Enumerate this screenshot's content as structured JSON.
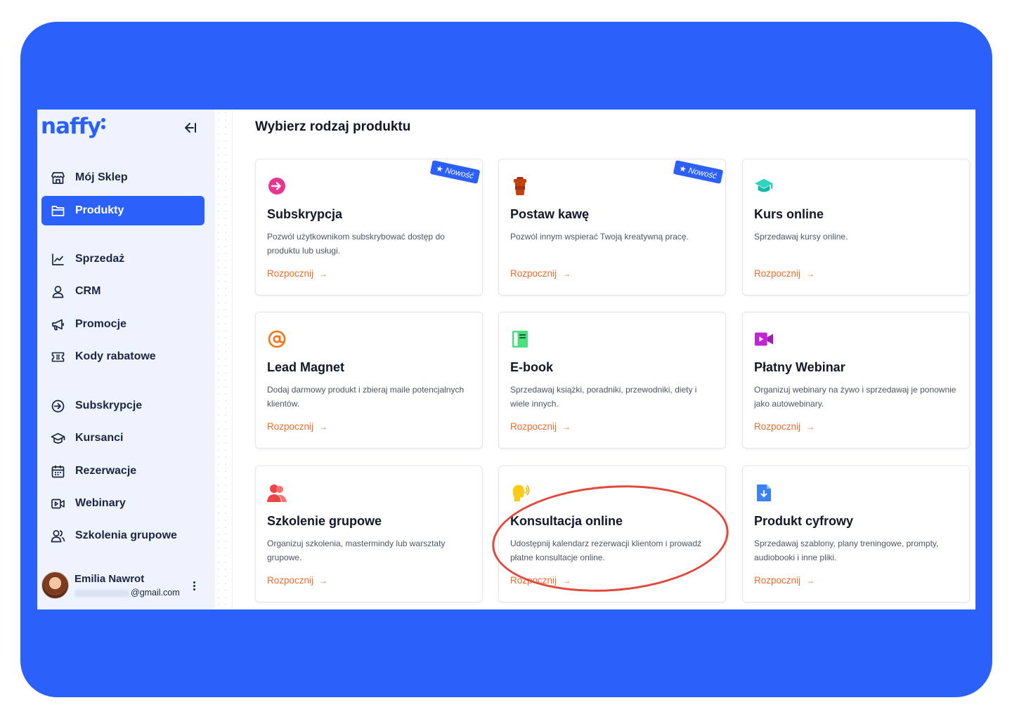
{
  "app": {
    "logo": "naffy"
  },
  "sidebar": {
    "items": [
      {
        "label": "Mój Sklep",
        "icon": "store-icon",
        "active": false
      },
      {
        "label": "Produkty",
        "icon": "folder-icon",
        "active": true
      },
      {
        "label": "Sprzedaż",
        "icon": "chart-line-icon",
        "active": false
      },
      {
        "label": "CRM",
        "icon": "user-icon",
        "active": false
      },
      {
        "label": "Promocje",
        "icon": "megaphone-icon",
        "active": false
      },
      {
        "label": "Kody rabatowe",
        "icon": "ticket-icon",
        "active": false
      },
      {
        "label": "Subskrypcje",
        "icon": "subscription-icon",
        "active": false
      },
      {
        "label": "Kursanci",
        "icon": "graduation-cap-icon",
        "active": false
      },
      {
        "label": "Rezerwacje",
        "icon": "calendar-icon",
        "active": false
      },
      {
        "label": "Webinary",
        "icon": "video-icon",
        "active": false
      },
      {
        "label": "Szkolenia grupowe",
        "icon": "users-icon",
        "active": false
      }
    ],
    "user": {
      "name": "Emilia Nawrot",
      "email_suffix": "@gmail.com"
    }
  },
  "main": {
    "title": "Wybierz rodzaj produktu",
    "start_label": "Rozpocznij",
    "badge_label": "★ Nowość",
    "cards": [
      {
        "title": "Subskrypcja",
        "desc": "Pozwól użytkownikom subskrybować dostęp do produktu lub usługi.",
        "icon": "subscription-icon",
        "color": "#e8358f",
        "badge": true
      },
      {
        "title": "Postaw kawę",
        "desc": "Pozwól innym wspierać Twoją kreatywną pracę.",
        "icon": "coffee-cup-icon",
        "color": "#c2410c",
        "badge": true
      },
      {
        "title": "Kurs online",
        "desc": "Sprzedawaj kursy online.",
        "icon": "graduation-cap-icon",
        "color": "#2dd4bf",
        "badge": false
      },
      {
        "title": "Lead Magnet",
        "desc": "Dodaj darmowy produkt i zbieraj maile potencjalnych klientów.",
        "icon": "at-sign-icon",
        "color": "#f97316",
        "badge": false
      },
      {
        "title": "E-book",
        "desc": "Sprzedawaj książki, poradniki, przewodniki, diety i wiele innych.",
        "icon": "book-icon",
        "color": "#4ade80",
        "badge": false
      },
      {
        "title": "Płatny Webinar",
        "desc": "Organizuj webinary na żywo i sprzedawaj je ponownie jako autowebinary.",
        "icon": "video-camera-icon",
        "color": "#c026d3",
        "badge": false
      },
      {
        "title": "Szkolenie grupowe",
        "desc": "Organizuj szkolenia, mastermindy lub warsztaty grupowe.",
        "icon": "users-icon",
        "color": "#ef4444",
        "badge": false
      },
      {
        "title": "Konsultacja online",
        "desc": "Udostępnij kalendarz rezerwacji klientom i prowadź płatne konsultacje online.",
        "icon": "speaking-head-icon",
        "color": "#facc15",
        "badge": false
      },
      {
        "title": "Produkt cyfrowy",
        "desc": "Sprzedawaj szablony, plany treningowe, prompty, audiobooki i inne pliki.",
        "icon": "download-file-icon",
        "color": "#3b82f6",
        "badge": false
      }
    ]
  }
}
